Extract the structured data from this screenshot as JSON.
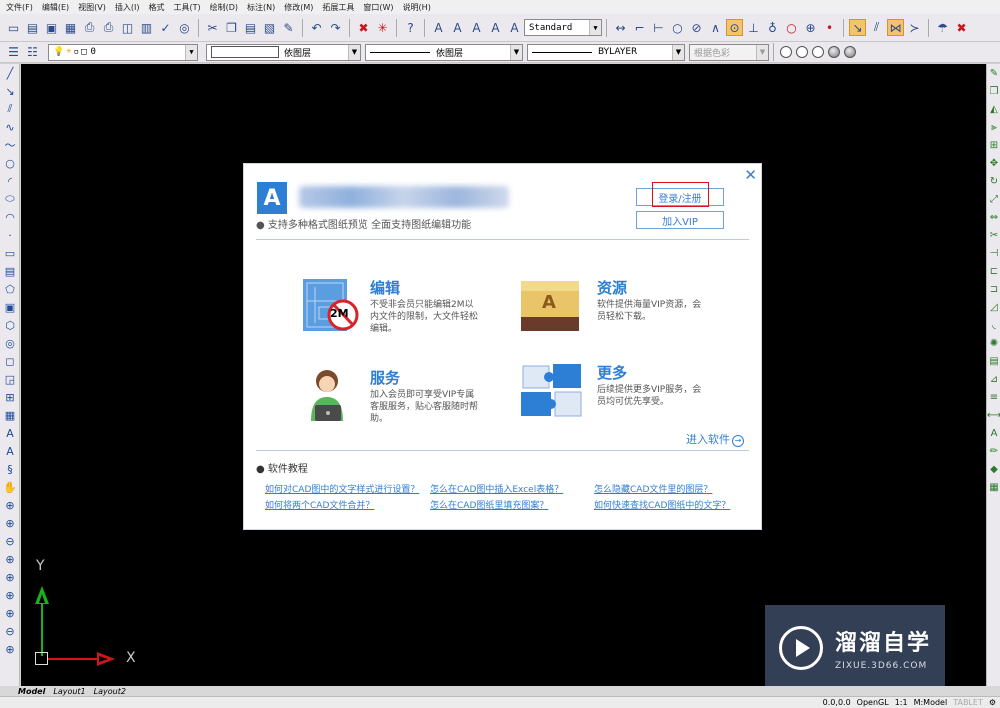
{
  "menubar": [
    "文件(F)",
    "编辑(E)",
    "视图(V)",
    "插入(I)",
    "格式",
    "工具(T)",
    "绘制(D)",
    "标注(N)",
    "修改(M)",
    "拓展工具",
    "窗口(W)",
    "说明(H)"
  ],
  "toolbar": {
    "text_style": "Standard"
  },
  "layerbar": {
    "layer_value": "0",
    "color_label": "依图层",
    "linetype_label": "依图层",
    "lineweight_label": "BYLAYER",
    "plotstyle_label": "根据色彩"
  },
  "canvas": {
    "y_axis_label": "Y",
    "x_axis_label": "X"
  },
  "dialog": {
    "logo_letter": "A",
    "subtitle": "● 支持多种格式图纸预览 全面支持图纸编辑功能",
    "login_label": "登录/注册",
    "vip_label": "加入VIP",
    "close_glyph": "✕",
    "features": [
      {
        "title": "编辑",
        "desc": "不受非会员只能编辑2M以内文件的限制，大文件轻松编辑。",
        "badge": "2M"
      },
      {
        "title": "资源",
        "desc": "软件提供海量VIP资源，会员轻松下载。",
        "badge": "A"
      },
      {
        "title": "服务",
        "desc": "加入会员即可享受VIP专属客服服务，贴心客服随时帮助。"
      },
      {
        "title": "更多",
        "desc": "后续提供更多VIP服务，会员均可优先享受。"
      }
    ],
    "enter_label": "进入软件",
    "tutorial_title": "● 软件教程",
    "tutorials": [
      "如何对CAD图中的文字样式进行设置？",
      "怎么在CAD图中插入Excel表格？",
      "怎么隐藏CAD文件里的图层？",
      "如何将两个CAD文件合并？",
      "怎么在CAD图纸里填充图案？",
      "如何快速查找CAD图纸中的文字？"
    ]
  },
  "tabs": [
    "Model",
    "Layout1",
    "Layout2"
  ],
  "status": {
    "coords": "0.0,0.0",
    "renderer": "OpenGL",
    "scale": "1:1",
    "model": "M:Model",
    "tablet": "TABLET"
  },
  "watermark": {
    "title": "溜溜自学",
    "subtitle": "ZIXUE.3D66.COM"
  }
}
